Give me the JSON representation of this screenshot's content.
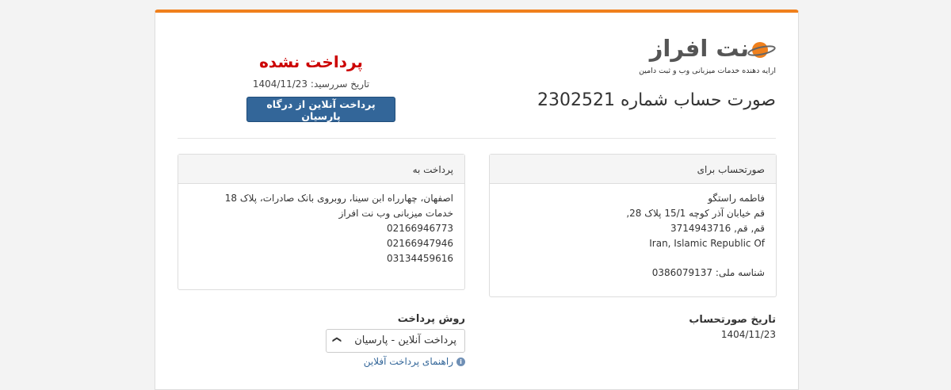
{
  "brand": {
    "name": "نت افراز",
    "tagline": "ارایه دهنده خدمات میزبانی وب و ثبت دامین",
    "accent_color": "#f0801c"
  },
  "invoice": {
    "title": "صورت حساب شماره 2302521",
    "status": "پرداخت نشده",
    "status_color": "#cc0000",
    "due_label": "تاریخ سررسید:",
    "due_date": "1404/11/23",
    "pay_button": "پرداخت آنلاین از درگاه پارسیان",
    "date_label": "تاریخ صورتحساب",
    "date_value": "1404/11/23"
  },
  "invoiced_to": {
    "heading": "صورتحساب برای",
    "lines": [
      "فاطمه راستگو",
      "قم خیابان آذر کوچه 15/1 پلاک 28,",
      "قم, قم, 3714943716",
      "Iran, Islamic Republic Of"
    ],
    "national_id_label": "شناسه ملی:",
    "national_id": "0386079137"
  },
  "pay_to": {
    "heading": "پرداخت به",
    "lines": [
      "اصفهان، چهارراه ابن سینا، روبروی بانک صادرات، پلاک 18",
      "خدمات میزبانی وب نت افراز",
      "02166946773",
      "02166947946",
      "03134459616"
    ]
  },
  "payment_method": {
    "label": "روش پرداخت",
    "selected": "پرداخت آنلاین - پارسیان",
    "help_link": "راهنمای پرداخت آفلاین"
  }
}
